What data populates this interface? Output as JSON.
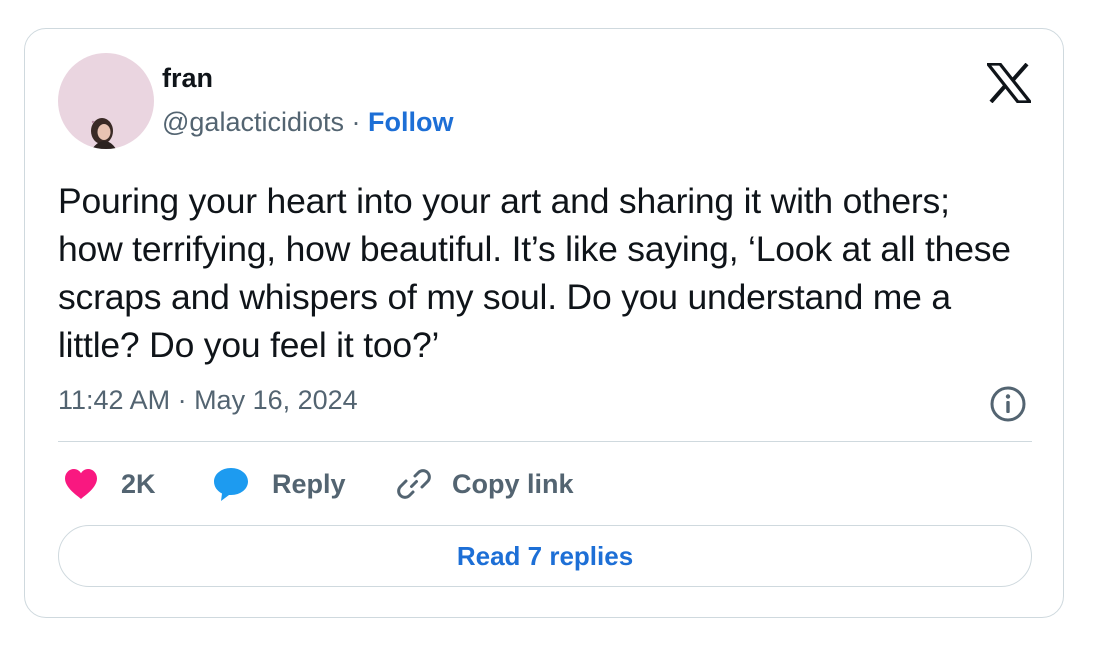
{
  "author": {
    "display_name": "fran",
    "handle": "@galacticidiots",
    "separator": "·",
    "follow_label": "Follow"
  },
  "tweet": {
    "text": "Pouring your heart into your art and sharing it with others; how terrifying, how beautiful. It’s like saying, ‘Look at all these scraps and whispers of my soul. Do you understand me a little? Do you feel it too?’",
    "timestamp": "11:42 AM · May 16, 2024"
  },
  "actions": {
    "like_count": "2K",
    "reply_label": "Reply",
    "copy_link_label": "Copy link"
  },
  "read_replies_label": "Read 7 replies",
  "icons": {
    "logo": "x-logo-icon",
    "info": "info-icon",
    "like": "heart-icon",
    "reply": "speech-bubble-icon",
    "copy_link": "link-icon"
  },
  "colors": {
    "accent": "#1d6fd6",
    "like": "#f91880",
    "reply": "#1d9bf0",
    "muted_text": "#536471",
    "border": "#cfd9de",
    "avatar_bg": "#ead5e0"
  }
}
